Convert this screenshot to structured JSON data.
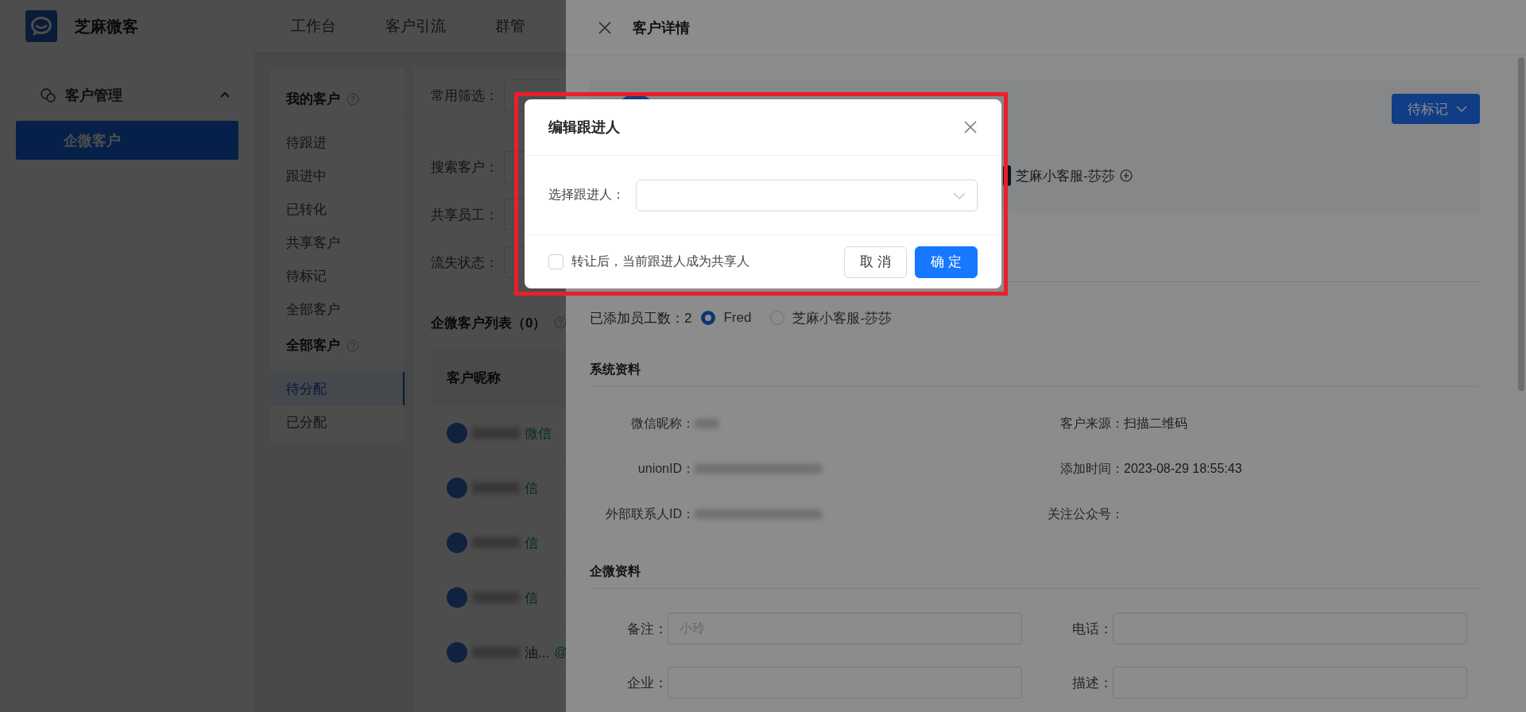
{
  "app": {
    "logo_text": "芝麻微客",
    "nav": [
      {
        "label": "工作台"
      },
      {
        "label": "客户引流"
      },
      {
        "label": "群管"
      }
    ],
    "sidebar": {
      "group": {
        "label": "客户管理",
        "expanded": true
      },
      "items": [
        {
          "label": "企微客户",
          "selected": true
        }
      ]
    },
    "customer_nav": [
      {
        "title": "我的客户",
        "items": [
          {
            "label": "待跟进",
            "selected": false
          },
          {
            "label": "跟进中",
            "selected": false
          },
          {
            "label": "已转化",
            "selected": false
          },
          {
            "label": "共享客户",
            "selected": false
          },
          {
            "label": "待标记",
            "selected": false
          },
          {
            "label": "全部客户",
            "selected": false
          }
        ]
      },
      {
        "title": "全部客户",
        "items": [
          {
            "label": "待分配",
            "selected": true
          },
          {
            "label": "已分配",
            "selected": false
          }
        ]
      }
    ],
    "filters": [
      {
        "label": "常用筛选："
      },
      {
        "label": "搜索客户："
      },
      {
        "label": "共享员工："
      },
      {
        "label": "流失状态："
      }
    ],
    "table": {
      "title": "企微客户列表（0）",
      "columns": [
        "客户昵称"
      ],
      "rows": [
        {
          "channel": "微信"
        },
        {
          "channel": "信"
        },
        {
          "channel": "信"
        },
        {
          "channel": "信"
        },
        {
          "name_tail": "油...",
          "channel": "@"
        }
      ]
    }
  },
  "drawer": {
    "title": "客户详情",
    "profile": {
      "tag_button": "待标记",
      "employees": [
        {
          "label": "芝麻小客服-莎莎"
        }
      ]
    },
    "staff_count_label": "已添加员工数：2",
    "staff": [
      {
        "label": "Fred",
        "selected": true
      },
      {
        "label": "芝麻小客服-莎莎",
        "selected": false
      }
    ],
    "sections": [
      {
        "title": "系统资料",
        "kind": "info",
        "fields": [
          {
            "label": "微信昵称：",
            "blurred": true
          },
          {
            "label": "客户来源：",
            "value": "扫描二维码"
          },
          {
            "label": "unionID：",
            "blurred": true
          },
          {
            "label": "添加时间：",
            "value": "2023-08-29 18:55:43"
          },
          {
            "label": "外部联系人ID：",
            "blurred": true
          },
          {
            "label": "关注公众号："
          }
        ]
      },
      {
        "title": "企微资料",
        "kind": "form",
        "fields": [
          {
            "label": "备注：",
            "placeholder": "小玲"
          },
          {
            "label": "电话："
          },
          {
            "label": "企业："
          },
          {
            "label": "描述："
          }
        ]
      }
    ]
  },
  "modal": {
    "title": "编辑跟进人",
    "field_label": "选择跟进人：",
    "checkbox": {
      "label": "转让后，当前跟进人成为共享人",
      "checked": false
    },
    "buttons": [
      {
        "label": "取 消",
        "kind": "default"
      },
      {
        "label": "确 定",
        "kind": "primary"
      }
    ]
  }
}
